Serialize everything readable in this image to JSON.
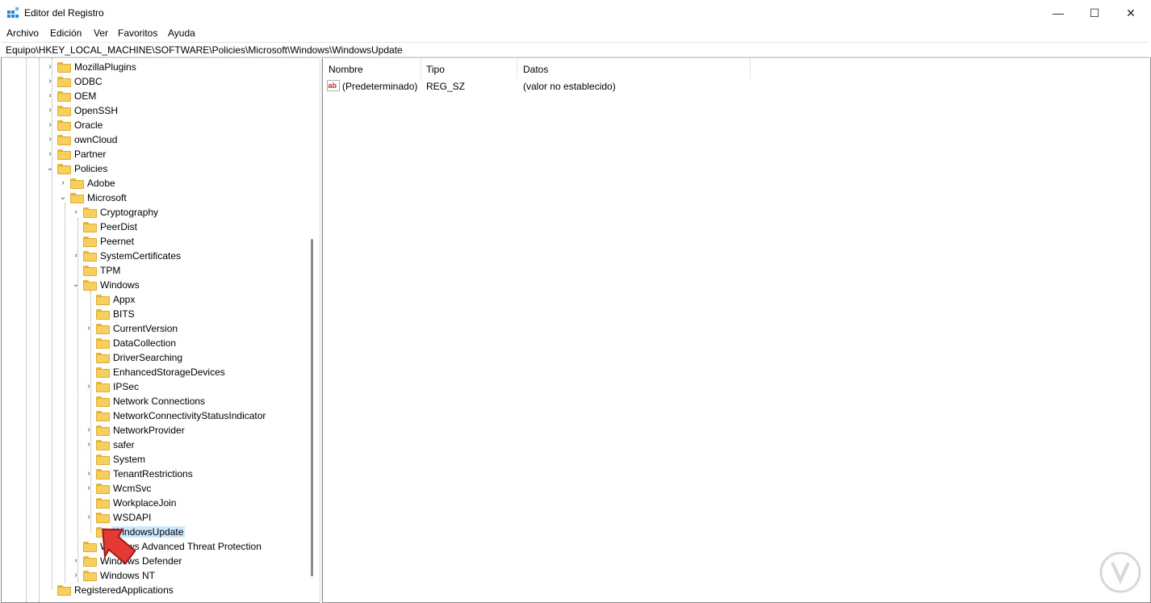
{
  "window": {
    "title": "Editor del Registro",
    "icon": "regedit-icon",
    "controls": {
      "minimize": "—",
      "maximize": "☐",
      "close": "✕"
    }
  },
  "menu": {
    "archivo": "Archivo",
    "edicion": "Edición",
    "ver": "Ver",
    "favoritos": "Favoritos",
    "ayuda": "Ayuda"
  },
  "address": "Equipo\\HKEY_LOCAL_MACHINE\\SOFTWARE\\Policies\\Microsoft\\Windows\\WindowsUpdate",
  "tree": {
    "mozillaplugins": "MozillaPlugins",
    "odbc": "ODBC",
    "oem": "OEM",
    "openssh": "OpenSSH",
    "oracle": "Oracle",
    "owncloud": "ownCloud",
    "partner": "Partner",
    "policies": "Policies",
    "adobe": "Adobe",
    "microsoft": "Microsoft",
    "cryptography": "Cryptography",
    "peerdist": "PeerDist",
    "peernet": "Peernet",
    "systemcertificates": "SystemCertificates",
    "tpm": "TPM",
    "windows": "Windows",
    "appx": "Appx",
    "bits": "BITS",
    "currentversion": "CurrentVersion",
    "datacollection": "DataCollection",
    "driversearching": "DriverSearching",
    "enhancedstoragedevices": "EnhancedStorageDevices",
    "ipsec": "IPSec",
    "networkconnections": "Network Connections",
    "ncsi": "NetworkConnectivityStatusIndicator",
    "networkprovider": "NetworkProvider",
    "safer": "safer",
    "system": "System",
    "tenantrestrictions": "TenantRestrictions",
    "wcmsvc": "WcmSvc",
    "workplacejoin": "WorkplaceJoin",
    "wsdapi": "WSDAPI",
    "windowsupdate": "WindowsUpdate",
    "watp": "Windows Advanced Threat Protection",
    "windowsdefender": "Windows Defender",
    "windowsnt": "Windows NT",
    "registeredapplications": "RegisteredApplications"
  },
  "list": {
    "columns": {
      "name": "Nombre",
      "type": "Tipo",
      "data": "Datos"
    },
    "rows": [
      {
        "name": "(Predeterminado)",
        "type": "REG_SZ",
        "data": "(valor no establecido)",
        "icon": "reg-sz-icon"
      }
    ]
  },
  "colors": {
    "selection": "#cce8ff",
    "folder": "#f7cf5e",
    "arrow": "#e53935",
    "scrollbar": "#8a8a8a"
  }
}
